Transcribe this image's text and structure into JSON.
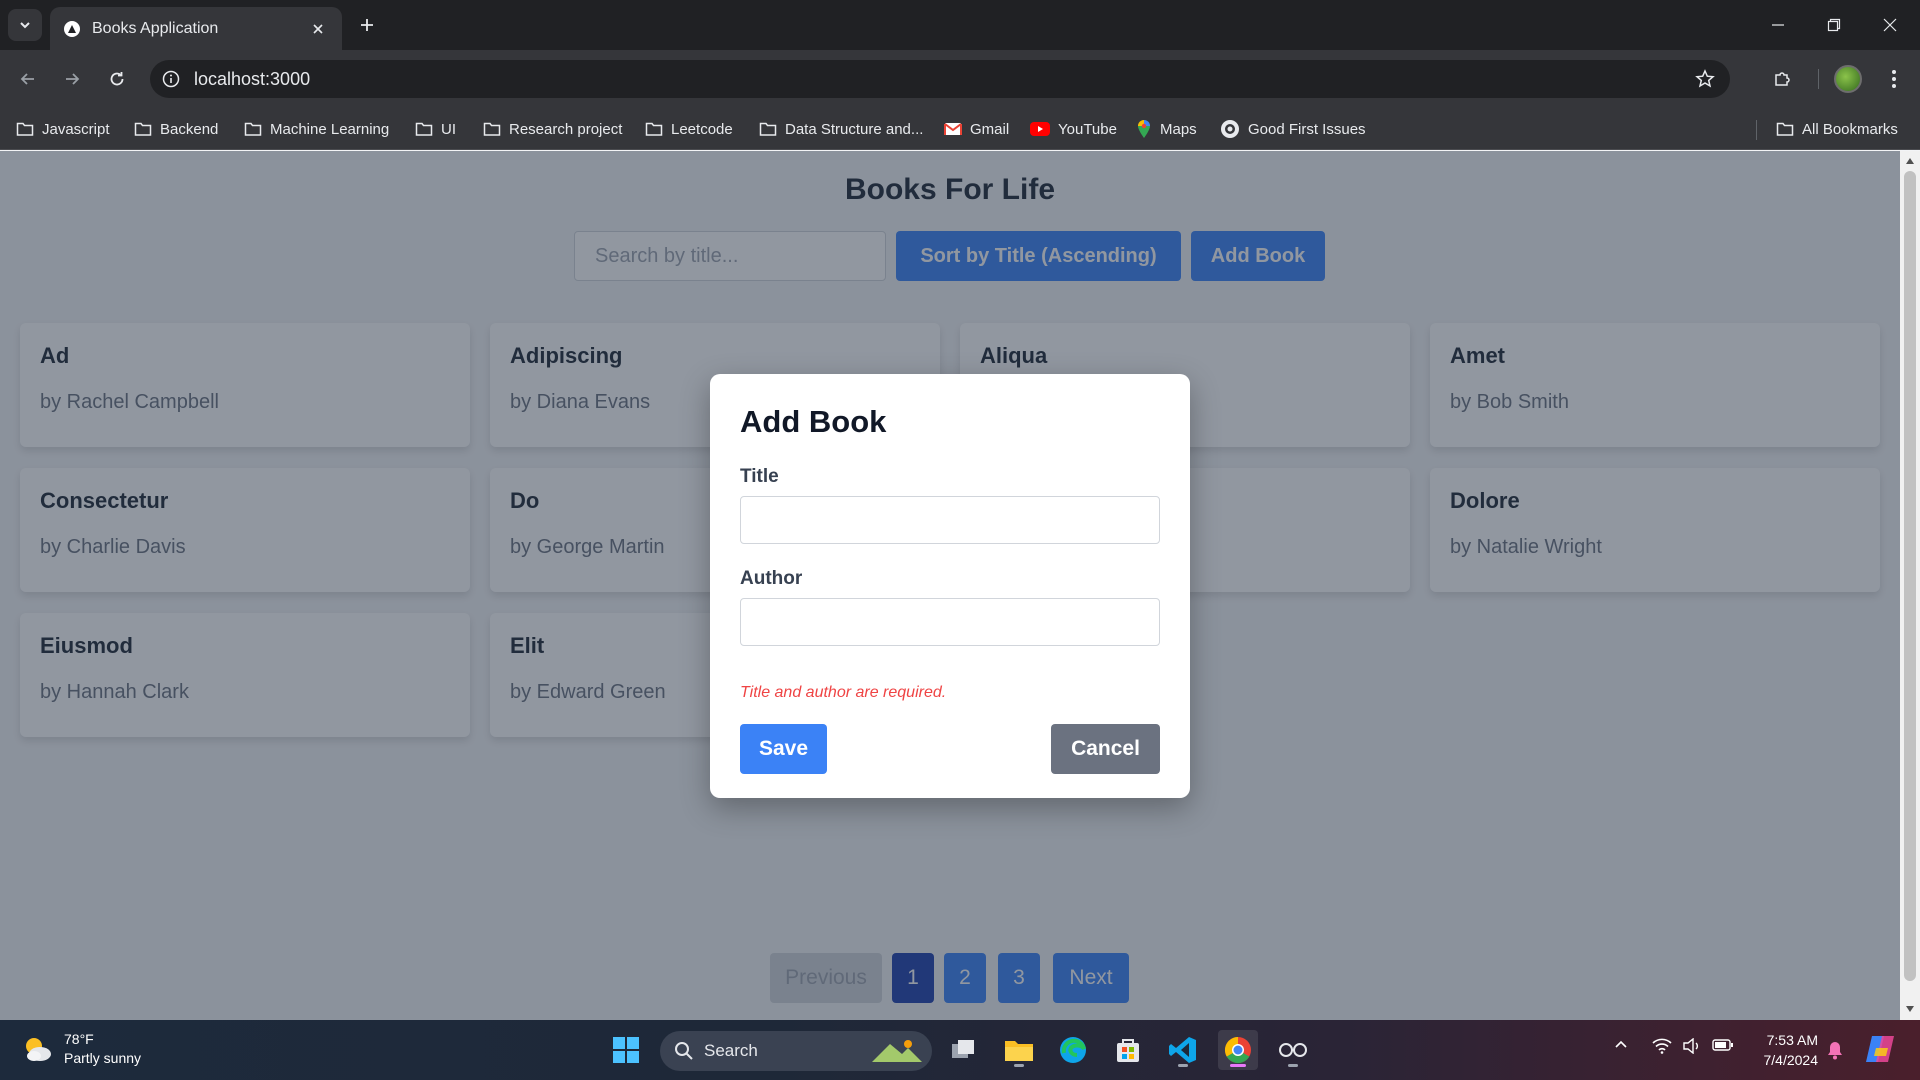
{
  "browser": {
    "tab_title": "Books Application",
    "url": "localhost:3000",
    "bookmarks": [
      {
        "label": "Javascript",
        "icon": "folder-icon"
      },
      {
        "label": "Backend",
        "icon": "folder-icon"
      },
      {
        "label": "Machine Learning",
        "icon": "folder-icon"
      },
      {
        "label": "UI",
        "icon": "folder-icon"
      },
      {
        "label": "Research project",
        "icon": "folder-icon"
      },
      {
        "label": "Leetcode",
        "icon": "folder-icon"
      },
      {
        "label": "Data Structure and...",
        "icon": "folder-icon"
      },
      {
        "label": "Gmail",
        "icon": "gmail-icon"
      },
      {
        "label": "YouTube",
        "icon": "youtube-icon"
      },
      {
        "label": "Maps",
        "icon": "maps-icon"
      },
      {
        "label": "Good First Issues",
        "icon": "github-icon"
      }
    ],
    "all_bookmarks": "All Bookmarks"
  },
  "page": {
    "title": "Books For Life",
    "search_placeholder": "Search by title...",
    "sort_button": "Sort by Title (Ascending)",
    "add_button": "Add Book",
    "books": [
      {
        "title": "Ad",
        "author": "by Rachel Campbell"
      },
      {
        "title": "Adipiscing",
        "author": "by Diana Evans"
      },
      {
        "title": "Aliqua",
        "author": ""
      },
      {
        "title": "Amet",
        "author": "by Bob Smith"
      },
      {
        "title": "Consectetur",
        "author": "by Charlie Davis"
      },
      {
        "title": "Do",
        "author": "by George Martin"
      },
      {
        "title": "",
        "author": ""
      },
      {
        "title": "Dolore",
        "author": "by Natalie Wright"
      },
      {
        "title": "Eiusmod",
        "author": "by Hannah Clark"
      },
      {
        "title": "Elit",
        "author": "by Edward Green"
      }
    ],
    "pagination": {
      "previous": "Previous",
      "pages": [
        "1",
        "2",
        "3"
      ],
      "current": "1",
      "next": "Next"
    }
  },
  "modal": {
    "title": "Add Book",
    "title_label": "Title",
    "title_value": "",
    "author_label": "Author",
    "author_value": "",
    "error": "Title and author are required.",
    "save": "Save",
    "cancel": "Cancel"
  },
  "taskbar": {
    "weather_temp": "78°F",
    "weather_desc": "Partly sunny",
    "search": "Search",
    "time": "7:53 AM",
    "date": "7/4/2024"
  },
  "colors": {
    "primary": "#3b82f6",
    "primary_active": "#1e40af",
    "cancel": "#6b7280",
    "error": "#ef4444"
  }
}
